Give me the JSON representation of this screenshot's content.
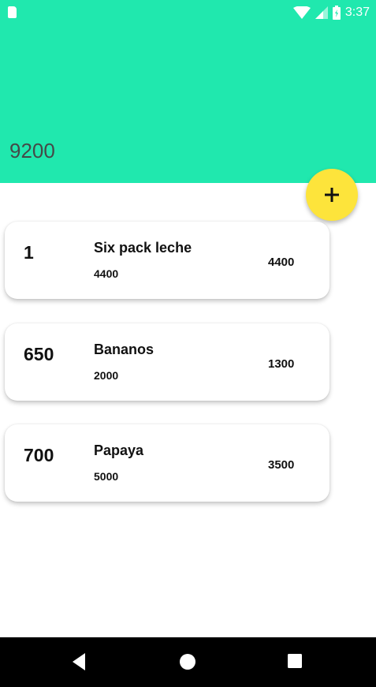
{
  "status_bar": {
    "time": "3:37",
    "icons": [
      "sd-card-icon",
      "wifi-icon",
      "signal-icon",
      "battery-icon"
    ]
  },
  "header": {
    "total": "9200",
    "background_color": "#20e8ae"
  },
  "fab": {
    "icon": "plus-icon",
    "color": "#fde43b"
  },
  "items": [
    {
      "quantity": "1",
      "name": "Six pack leche",
      "unit_price": "4400",
      "total": "4400"
    },
    {
      "quantity": "650",
      "name": "Bananos",
      "unit_price": "2000",
      "total": "1300"
    },
    {
      "quantity": "700",
      "name": "Papaya",
      "unit_price": "5000",
      "total": "3500"
    }
  ],
  "nav_bar": {
    "icons": [
      "back-icon",
      "home-icon",
      "recents-icon"
    ]
  }
}
